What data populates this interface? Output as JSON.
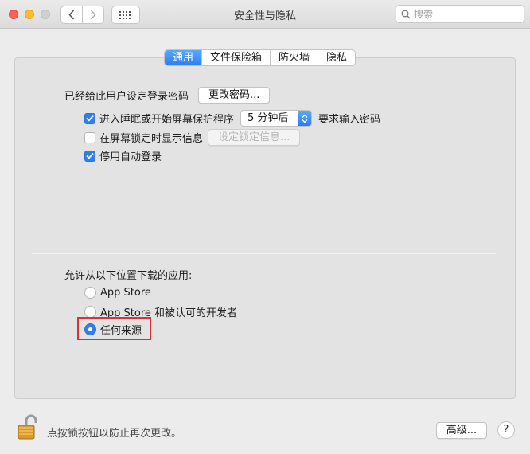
{
  "window": {
    "title": "安全性与隐私",
    "search_placeholder": "搜索"
  },
  "tabs": [
    {
      "label": "通用",
      "active": true
    },
    {
      "label": "文件保险箱",
      "active": false
    },
    {
      "label": "防火墙",
      "active": false
    },
    {
      "label": "隐私",
      "active": false
    }
  ],
  "general": {
    "password_label": "已经给此用户设定登录密码",
    "change_password_button": "更改密码...",
    "sleep_checkbox": {
      "label": "进入睡眠或开始屏幕保护程序",
      "checked": true
    },
    "sleep_delay": "5 分钟后",
    "sleep_suffix": "要求输入密码",
    "lock_message_checkbox": {
      "label": "在屏幕锁定时显示信息",
      "checked": false
    },
    "lock_message_button": "设定锁定信息...",
    "disable_autologin_checkbox": {
      "label": "停用自动登录",
      "checked": true
    }
  },
  "downloads": {
    "heading": "允许从以下位置下载的应用:",
    "options": [
      {
        "label": "App Store",
        "selected": false
      },
      {
        "label": "App Store 和被认可的开发者",
        "selected": false
      },
      {
        "label": "任何来源",
        "selected": true
      }
    ]
  },
  "footer": {
    "lock_text": "点按锁按钮以防止再次更改。",
    "advanced_button": "高级...",
    "help_button": "?"
  },
  "colors": {
    "accent": "#2f80ed",
    "highlight_box": "#e03131"
  }
}
